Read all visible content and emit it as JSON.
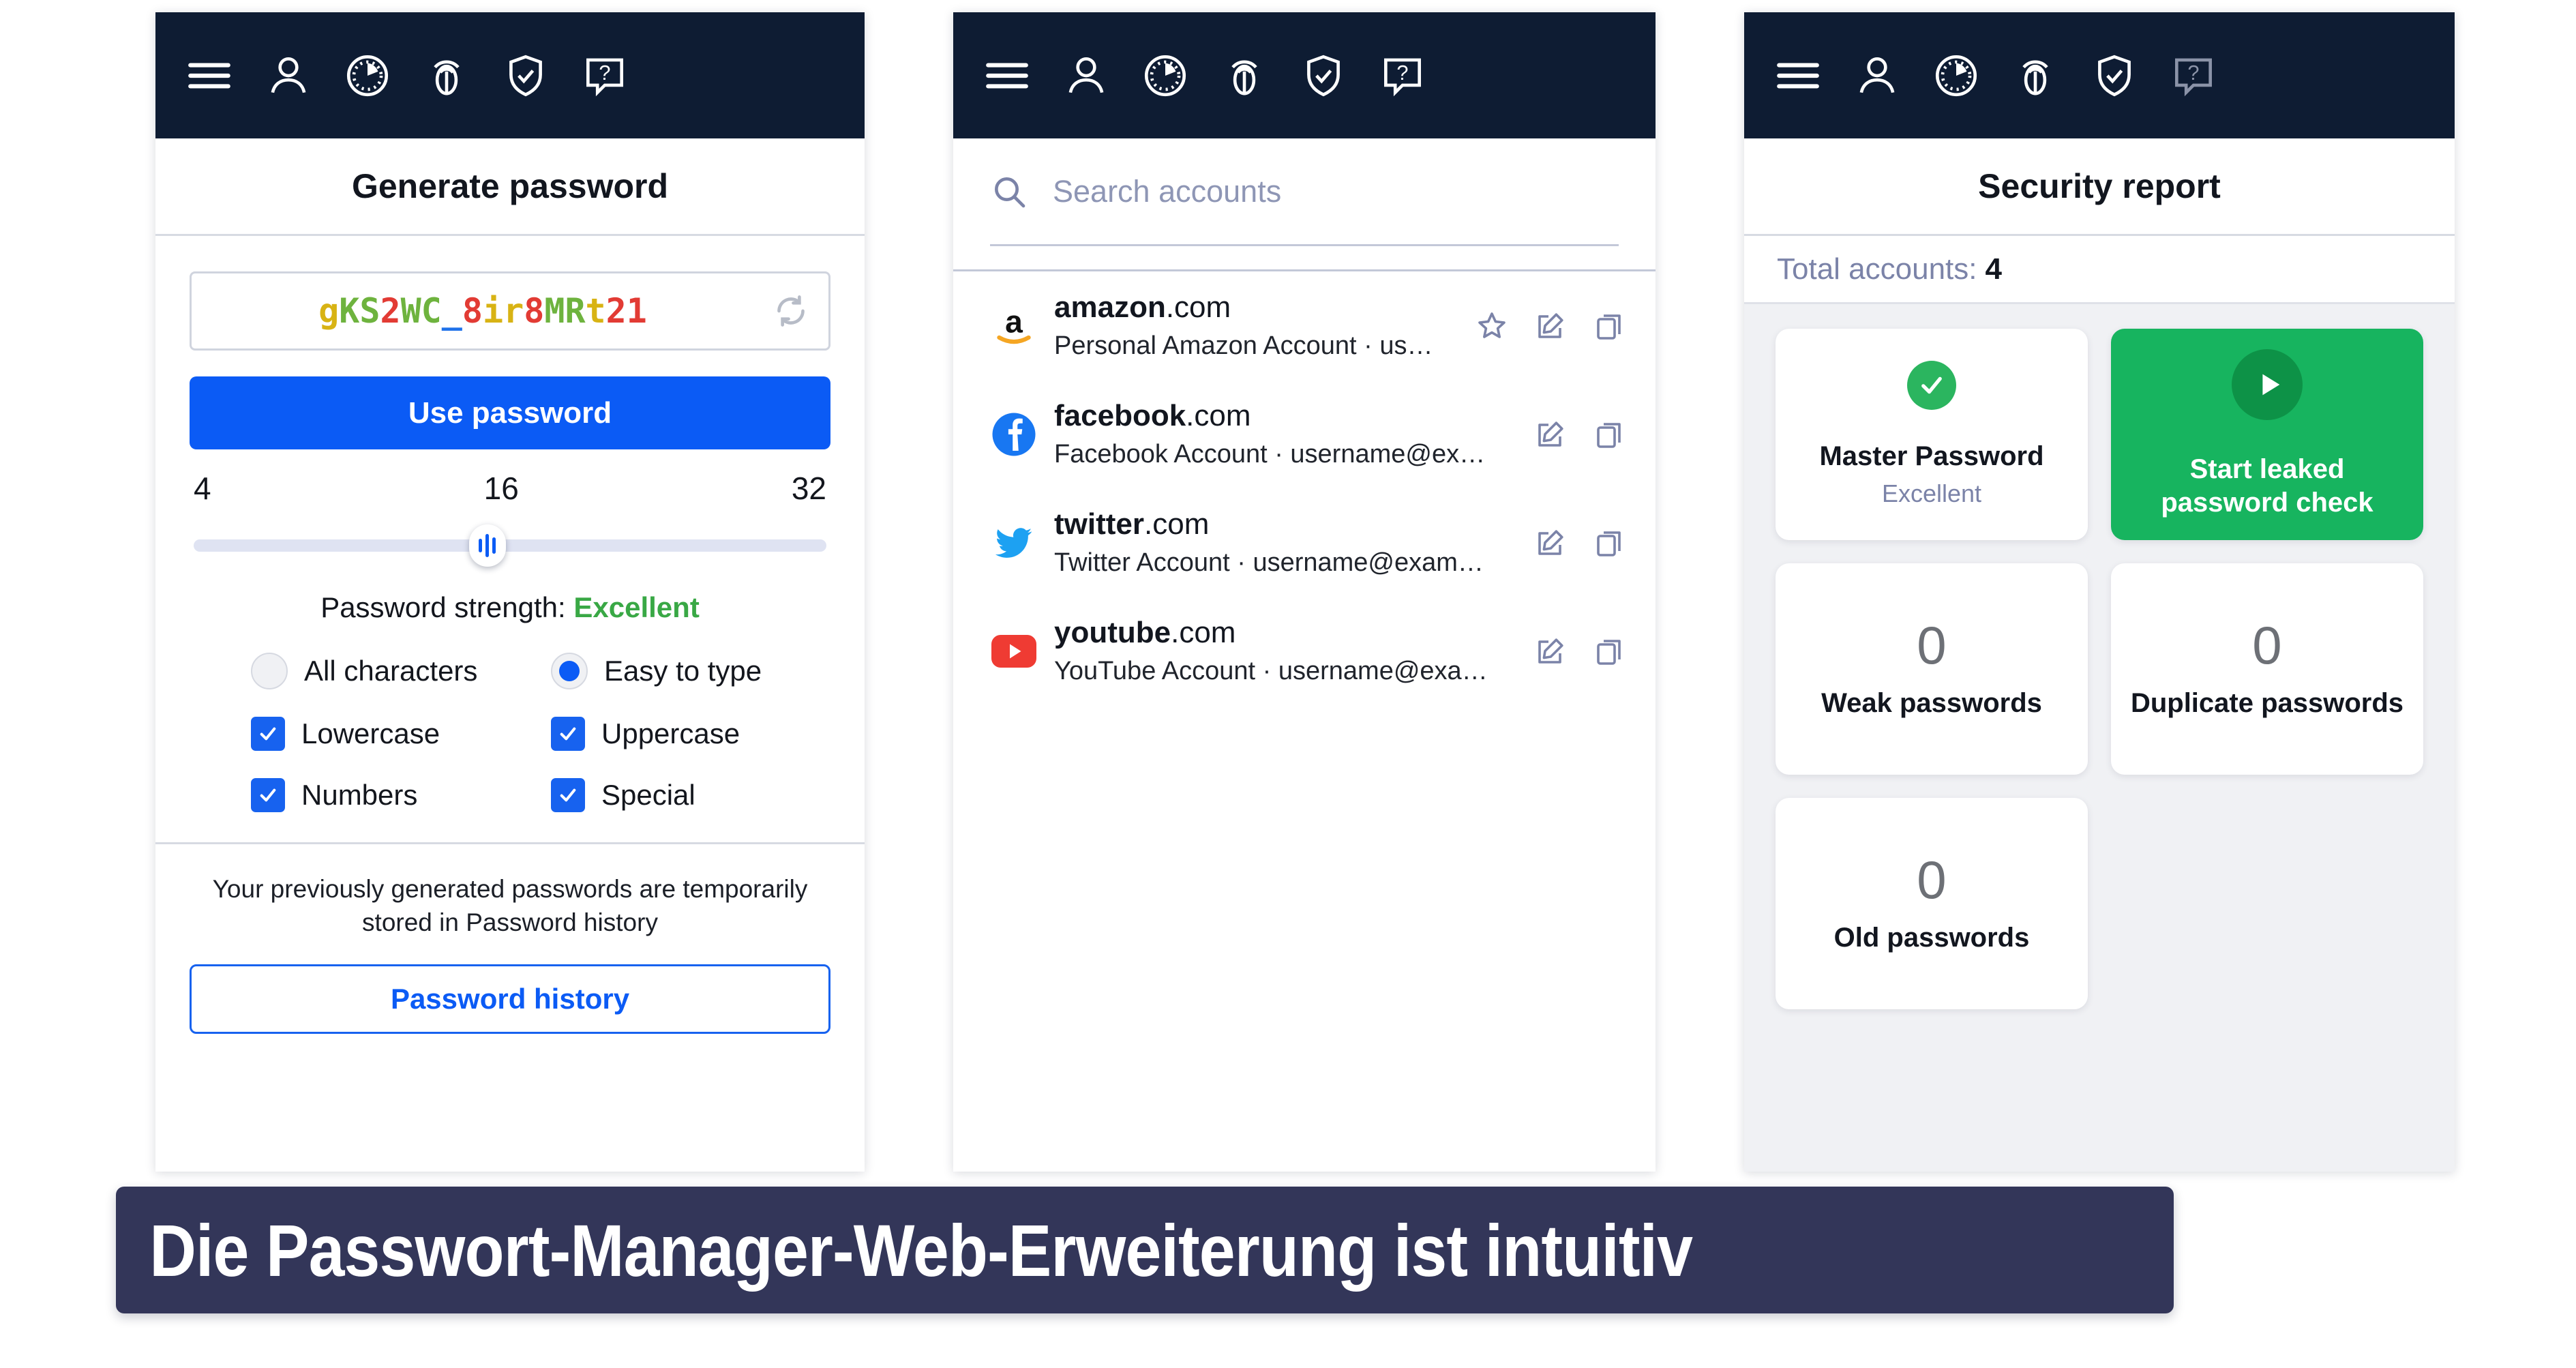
{
  "toolbar": {
    "icons": [
      {
        "name": "menu-icon",
        "label": "Menu"
      },
      {
        "name": "account-icon",
        "label": "Account"
      },
      {
        "name": "timer-icon",
        "label": "Timer"
      },
      {
        "name": "fingerprint-icon",
        "label": "Autofill"
      },
      {
        "name": "shield-check-icon",
        "label": "Security"
      },
      {
        "name": "help-icon",
        "label": "Help"
      }
    ]
  },
  "generate": {
    "title": "Generate password",
    "password": "gKS2WC_8ir8MRt21",
    "password_chars": [
      {
        "ch": "g",
        "color": "yellow"
      },
      {
        "ch": "K",
        "color": "green"
      },
      {
        "ch": "S",
        "color": "green"
      },
      {
        "ch": "2",
        "color": "red"
      },
      {
        "ch": "W",
        "color": "green"
      },
      {
        "ch": "C",
        "color": "green"
      },
      {
        "ch": "_",
        "color": "blue"
      },
      {
        "ch": "8",
        "color": "red"
      },
      {
        "ch": "i",
        "color": "yellow"
      },
      {
        "ch": "r",
        "color": "yellow"
      },
      {
        "ch": "8",
        "color": "red"
      },
      {
        "ch": "M",
        "color": "green"
      },
      {
        "ch": "R",
        "color": "green"
      },
      {
        "ch": "t",
        "color": "yellow"
      },
      {
        "ch": "2",
        "color": "red"
      },
      {
        "ch": "1",
        "color": "red"
      }
    ],
    "refresh_label": "Regenerate",
    "use_button": "Use password",
    "length_min": "4",
    "length_current": "16",
    "length_max": "32",
    "strength_prefix": "Password strength:",
    "strength_value": "Excellent",
    "options": [
      {
        "type": "radio",
        "label": "All characters",
        "checked": false
      },
      {
        "type": "radio",
        "label": "Easy to type",
        "checked": true
      },
      {
        "type": "checkbox",
        "label": "Lowercase",
        "checked": true
      },
      {
        "type": "checkbox",
        "label": "Uppercase",
        "checked": true
      },
      {
        "type": "checkbox",
        "label": "Numbers",
        "checked": true
      },
      {
        "type": "checkbox",
        "label": "Special",
        "checked": true
      }
    ],
    "history_note": "Your previously generated passwords are temporarily stored in Password history",
    "history_button": "Password history"
  },
  "accounts": {
    "search_placeholder": "Search accounts",
    "items": [
      {
        "domain_bold": "amazon",
        "domain_tld": ".com",
        "subtitle": "Personal Amazon Account · us…",
        "logo": "amazon-logo",
        "starred": true
      },
      {
        "domain_bold": "facebook",
        "domain_tld": ".com",
        "subtitle": "Facebook Account · username@exa…",
        "logo": "facebook-logo",
        "starred": false
      },
      {
        "domain_bold": "twitter",
        "domain_tld": ".com",
        "subtitle": "Twitter Account · username@exampl…",
        "logo": "twitter-logo",
        "starred": false
      },
      {
        "domain_bold": "youtube",
        "domain_tld": ".com",
        "subtitle": "YouTube Account · username@exam…",
        "logo": "youtube-logo",
        "starred": false
      }
    ]
  },
  "report": {
    "title": "Security report",
    "total_label": "Total accounts:",
    "total_value": "4",
    "master": {
      "label": "Master Password",
      "status": "Excellent"
    },
    "leak_check": {
      "label": "Start leaked password check"
    },
    "stats": [
      {
        "value": "0",
        "label": "Weak passwords"
      },
      {
        "value": "0",
        "label": "Duplicate passwords"
      },
      {
        "value": "0",
        "label": "Old passwords"
      }
    ]
  },
  "caption": {
    "text": "Die Passwort-Manager-Web-Erweiterung ist intuitiv"
  },
  "colors": {
    "topbar": "#0e1c33",
    "primary_blue": "#0b5bf5",
    "green": "#17b45f",
    "caption_bg": "#333659",
    "icon_slate": "#7b83a8"
  }
}
